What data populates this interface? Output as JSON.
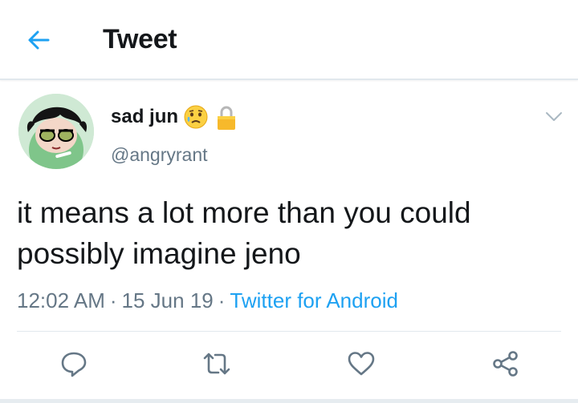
{
  "header": {
    "title": "Tweet",
    "back_icon": "back-arrow-icon"
  },
  "author": {
    "display_name": "sad jun",
    "handle": "@angryrant",
    "emojis": [
      "sad-face-emoji",
      "lock-emoji"
    ]
  },
  "tweet": {
    "text": "it means a lot more than you could possibly imagine jeno",
    "time": "12:02 AM",
    "date": "15 Jun 19",
    "source": "Twitter for Android",
    "separator": "·"
  },
  "actions": [
    "reply-icon",
    "retweet-icon",
    "like-icon",
    "share-icon"
  ],
  "colors": {
    "accent": "#1da1f2",
    "secondary_text": "#657786",
    "text": "#14171a",
    "divider": "#e1e8ed"
  }
}
